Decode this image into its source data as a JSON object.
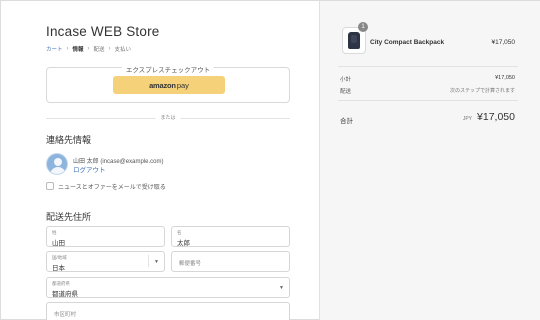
{
  "store": {
    "title": "Incase WEB Store"
  },
  "breadcrumb": {
    "cart": "カート",
    "info": "情報",
    "shipping": "配送",
    "payment": "支払い"
  },
  "express": {
    "label": "エクスプレスチェックアウト",
    "amazon_brand": "amazon",
    "amazon_pay": "pay"
  },
  "divider": {
    "label": "または"
  },
  "contact": {
    "title": "連絡先情報",
    "user": "山田 太郎 (incase@example.com)",
    "logout": "ログアウト",
    "newsletter_label": "ニュースとオファーをメールで受け取る"
  },
  "address": {
    "title": "配送先住所",
    "last_name": {
      "label": "姓",
      "value": "山田"
    },
    "first_name": {
      "label": "名",
      "value": "太郎"
    },
    "country": {
      "label": "国/地域",
      "value": "日本"
    },
    "zip": {
      "placeholder": "郵便番号"
    },
    "prefecture": {
      "label": "都道府県",
      "value": "都道府県"
    },
    "city": {
      "placeholder": "市区町村"
    }
  },
  "summary": {
    "quantity": "1",
    "product_name": "City Compact Backpack",
    "product_price": "¥17,050",
    "subtotal_label": "小計",
    "subtotal_value": "¥17,050",
    "shipping_label": "配送",
    "shipping_value": "次のステップで計算されます",
    "total_label": "合計",
    "currency": "JPY",
    "total_value": "¥17,050"
  },
  "colors": {
    "accent": "#3b6fb6",
    "amazon": "#f5d27a",
    "sidebar_bg": "#f6f6f6"
  }
}
